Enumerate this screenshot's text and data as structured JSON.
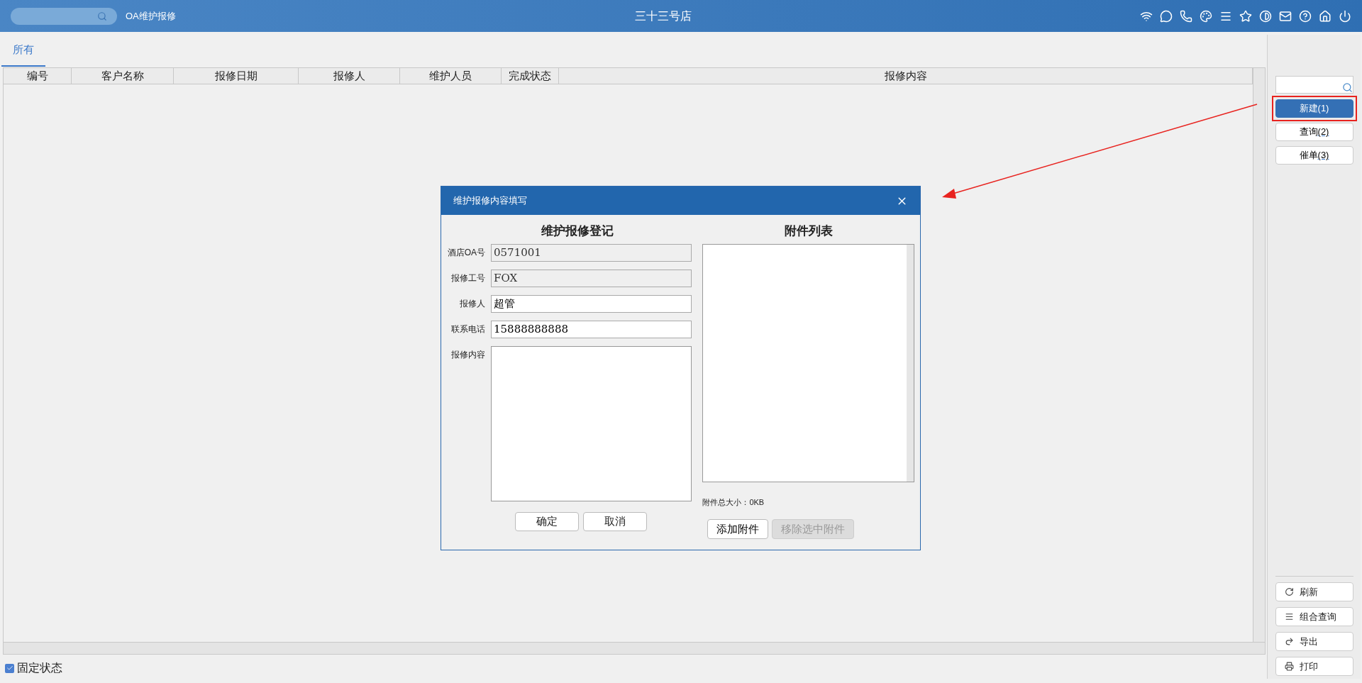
{
  "top_bar": {
    "module": "OA维护报修",
    "store": "三十三号店"
  },
  "tabs": [
    {
      "label": "所有",
      "selected": true
    }
  ],
  "table": {
    "columns": [
      "编号",
      "客户名称",
      "报修日期",
      "报修人",
      "维护人员",
      "完成状态",
      "报修内容"
    ]
  },
  "dialog": {
    "title": "维护报修内容填写",
    "left_heading": "维护报修登记",
    "fields": [
      {
        "kind": "input",
        "label": "酒店OA号",
        "value": "0571001",
        "readonly": true
      },
      {
        "kind": "input",
        "label": "报修工号",
        "value": "FOX",
        "readonly": true
      },
      {
        "kind": "input",
        "label": "报修人",
        "value": "超管",
        "readonly": false
      },
      {
        "kind": "input",
        "label": "联系电话",
        "value": "15888888888",
        "readonly": false
      },
      {
        "kind": "textarea",
        "label": "报修内容",
        "readonly": false
      }
    ],
    "left_buttons": [
      "确定",
      "取消"
    ],
    "right_heading": "附件列表",
    "attachment_size": "附件总大小：0KB",
    "right_buttons": [
      {
        "label": "添加附件",
        "disabled": false
      },
      {
        "label": "移除选中附件",
        "disabled": true
      }
    ]
  },
  "side_panel": {
    "actions": [
      {
        "label": "新建",
        "shortcut": "(1)",
        "primary": true,
        "highlighted": true
      },
      {
        "label": "查询",
        "shortcut": "(2)",
        "primary": false,
        "highlighted": false
      },
      {
        "label": "催单",
        "shortcut": "(3)",
        "primary": false,
        "highlighted": false
      }
    ],
    "tools": [
      {
        "kind": "refresh",
        "label": "刷新"
      },
      {
        "kind": "list",
        "label": "组合查询"
      },
      {
        "kind": "export",
        "label": "导出"
      },
      {
        "kind": "print",
        "label": "打印"
      }
    ]
  },
  "footer": {
    "label": "固定状态",
    "checked": true
  }
}
